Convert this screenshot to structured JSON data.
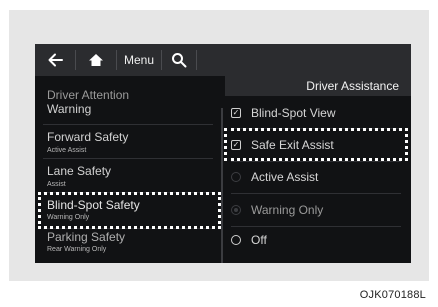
{
  "topbar": {
    "back_icon": "back-arrow-icon",
    "home_icon": "home-icon",
    "menu_label": "Menu",
    "search_icon": "search-icon"
  },
  "header": {
    "title": "Driver Assistance"
  },
  "left_menu": {
    "items": [
      {
        "title": "Driver Attention",
        "title2": "Warning",
        "sub": ""
      },
      {
        "title": "Forward Safety",
        "sub": "Active Assist"
      },
      {
        "title": "Lane Safety",
        "sub": "Assist"
      },
      {
        "title": "Blind-Spot Safety",
        "sub": "Warning Only",
        "highlighted": true
      },
      {
        "title": "Parking Safety",
        "sub": "Rear Warning Only"
      }
    ]
  },
  "options": {
    "blind_spot_view": {
      "label": "Blind-Spot View",
      "checked": true
    },
    "safe_exit_assist": {
      "label": "Safe Exit Assist",
      "checked": true,
      "highlighted": true
    },
    "active_assist": {
      "label": "Active Assist",
      "selected": false
    },
    "warning_only": {
      "label": "Warning Only",
      "selected": true
    },
    "off": {
      "label": "Off",
      "selected": false
    }
  },
  "image_code": "OJK070188L",
  "colors": {
    "screen_bg": "#111214",
    "bar_bg": "#2b2c2f",
    "frame_bg": "#e6e6e6",
    "highlight": "#ffffff"
  }
}
